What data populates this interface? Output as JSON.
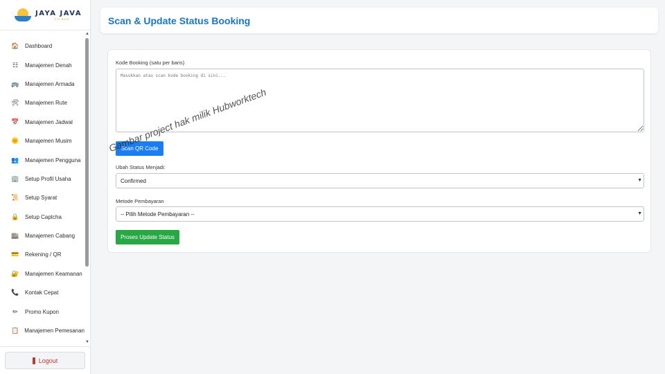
{
  "brand": {
    "title": "JAYA JAVA",
    "subtitle": "PO BUS"
  },
  "sidebar": {
    "items": [
      {
        "label": "Dashboard",
        "icon": "house-icon",
        "glyph": "🏠"
      },
      {
        "label": "Manajemen Denah",
        "icon": "seat-grid-icon",
        "glyph": "☷"
      },
      {
        "label": "Manajemen Armada",
        "icon": "bus-icon",
        "glyph": "🚌"
      },
      {
        "label": "Manajemen Rute",
        "icon": "tools-icon",
        "glyph": "🛠"
      },
      {
        "label": "Manajemen Jadwal",
        "icon": "calendar-icon",
        "glyph": "📅"
      },
      {
        "label": "Manajemen Musim",
        "icon": "sun-face-icon",
        "glyph": "🌞"
      },
      {
        "label": "Manajemen Pengguna",
        "icon": "users-icon",
        "glyph": "👥"
      },
      {
        "label": "Setup Profil Usaha",
        "icon": "building-icon",
        "glyph": "🏢"
      },
      {
        "label": "Setup Syarat",
        "icon": "scroll-icon",
        "glyph": "📜"
      },
      {
        "label": "Setup Captcha",
        "icon": "lock-icon",
        "glyph": "🔒"
      },
      {
        "label": "Manajemen Cabang",
        "icon": "office-icon",
        "glyph": "🏬"
      },
      {
        "label": "Rekening / QR",
        "icon": "card-icon",
        "glyph": "💳"
      },
      {
        "label": "Manajemen Keamanan",
        "icon": "padlock-icon",
        "glyph": "🔐"
      },
      {
        "label": "Kontak Cepat",
        "icon": "phone-icon",
        "glyph": "📞"
      },
      {
        "label": "Promo Kupon",
        "icon": "pen-icon",
        "glyph": "✏"
      },
      {
        "label": "Manajemen Pemesanan",
        "icon": "clipboard-icon",
        "glyph": "📋"
      }
    ],
    "logout_label": "Logout"
  },
  "header": {
    "title": "Scan & Update Status Booking"
  },
  "form": {
    "booking_label": "Kode Booking (satu per baris)",
    "booking_placeholder": "Masukkan atau scan kode booking di sini...",
    "scan_button": "Scan QR Code",
    "status_label": "Ubah Status Menjadi:",
    "status_value": "Confirmed",
    "payment_label": "Metode Pembayaran",
    "payment_value": "-- Pilih Metode Pembayaran --",
    "submit_button": "Proses Update Status"
  },
  "watermark": "Gambar project hak milik Hubworktech",
  "colors": {
    "accent": "#1a74c4",
    "primary_button": "#1a7ef2",
    "success_button": "#28a745",
    "logout": "#c0392b"
  }
}
